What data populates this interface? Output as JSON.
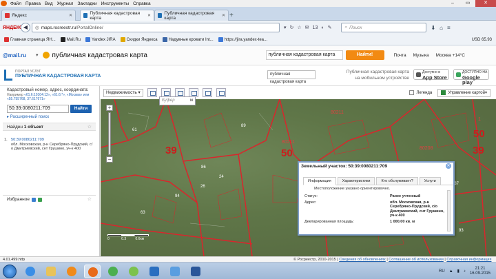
{
  "browser": {
    "menu": [
      "Файл",
      "Правка",
      "Вид",
      "Журнал",
      "Закладки",
      "Инструменты",
      "Справка"
    ],
    "tabs": [
      {
        "label": "Яндекс",
        "active": false
      },
      {
        "label": "Публичная кадастровая карта",
        "active": true
      },
      {
        "label": "Публичная кадастровая карта",
        "active": false
      }
    ],
    "logo": "ЯНДЕКС",
    "url_host": "maps.rosreestr.ru",
    "url_path": "/PortalOnline/",
    "nav_badge": "13",
    "search_placeholder": "Поиск",
    "rate": "USD 65.93"
  },
  "bookmarks": [
    {
      "label": "Главная страница ЯН...",
      "color": "#d33"
    },
    {
      "label": "Mail.Ru",
      "color": "#222"
    },
    {
      "label": "Yandex JIRA",
      "color": "#3c78d8"
    },
    {
      "label": "Скидки Яндекса",
      "color": "#e0a800"
    },
    {
      "label": "Надувные кровати Int...",
      "color": "#3a66a8"
    },
    {
      "label": "https://jira.yandex-tea...",
      "color": "#3c78d8"
    }
  ],
  "bookmarks_right": [
    "Музыка",
    "Москва +14°C"
  ],
  "mailru_bar": {
    "brand": "@mail.ru",
    "query": "публичная кадастровая карта",
    "input": "публичная кадастровая карта",
    "find_button": "Найти!",
    "links": [
      "Почта",
      "Музыка",
      "Москва +14°C"
    ]
  },
  "portal": {
    "logo_top": "ПОРТАЛ УСЛУГ",
    "logo_title": "ПУБЛИЧНАЯ КАДАСТРОВАЯ КАРТА",
    "mobile_line1": "Публичная кадастровая карта",
    "mobile_line2": "на мобильном устройстве",
    "appstore_top": "Доступно в",
    "appstore": "App Store",
    "gplay_top": "ДОСТУПНО НА",
    "gplay": "Google play"
  },
  "sidebar": {
    "search_label": "Кадастровый номер, адрес, координата:",
    "example_prefix": "Например",
    "example_values": "«61:6:10104:12», «61:6:*», «Москва» или «55.755768, 37.617671»",
    "search_value": "50:39:0080211:709",
    "find_button": "Найти",
    "extended_search": "Расширенный поиск",
    "found_prefix": "Найден",
    "found_count": "1 объект",
    "result_num": "1.",
    "result_link": "50:39:0080211:709",
    "result_address": "обл. Московская, р-н Серебряно-Прудский, с/о Дмитриевский, снт Грушино, уч-к 400",
    "favorites": "Избранное",
    "version": "4.01.499.http"
  },
  "toolbar": {
    "layer": "Недвижимость",
    "buffer_placeholder": "Буфер",
    "buffer_unit": "м",
    "legend": "Легенда",
    "map_control": "Управление картой"
  },
  "map": {
    "scale_labels": [
      "0",
      "0.3",
      "0.6км"
    ],
    "labels": {
      "big39a": "39",
      "big50a": "50",
      "big39b": "39",
      "big50b": "50",
      "big39c": "39",
      "big50c": "50",
      "red80211": "80211",
      "red80208": "80208",
      "red80211b": "80211",
      "red1": "1",
      "w61": "61",
      "w50": "50",
      "w89": "89",
      "w86": "86",
      "w26": "26",
      "w24": "24",
      "w94": "94",
      "w63": "63",
      "w93": "93",
      "w137": "137"
    }
  },
  "popup": {
    "title": "Земельный участок: 50:39:0080211:709",
    "tabs": [
      "Информация",
      "Характеристики",
      "Кто обслуживает?",
      "Услуги"
    ],
    "note": "Местоположение указано ориентировочно.",
    "rows": [
      {
        "k": "Статус:",
        "v": "Ранее учтенный"
      },
      {
        "k": "Адрес:",
        "v": "обл. Московская, р-н Серебряно-Прудский, с/о Дмитриевский, снт Грушино, уч-к 400"
      },
      {
        "k": "Декларированная площадь:",
        "v": "1 000.00 кв. м"
      }
    ]
  },
  "statusbar": {
    "copyright": "© Росреестр, 2010-2015",
    "links": [
      "Сведения об обновлениях",
      "Соглашение об использовании",
      "Справочная информация"
    ]
  },
  "taskbar": {
    "lang": "RU",
    "time": "21:21",
    "date": "16.09.2015"
  }
}
